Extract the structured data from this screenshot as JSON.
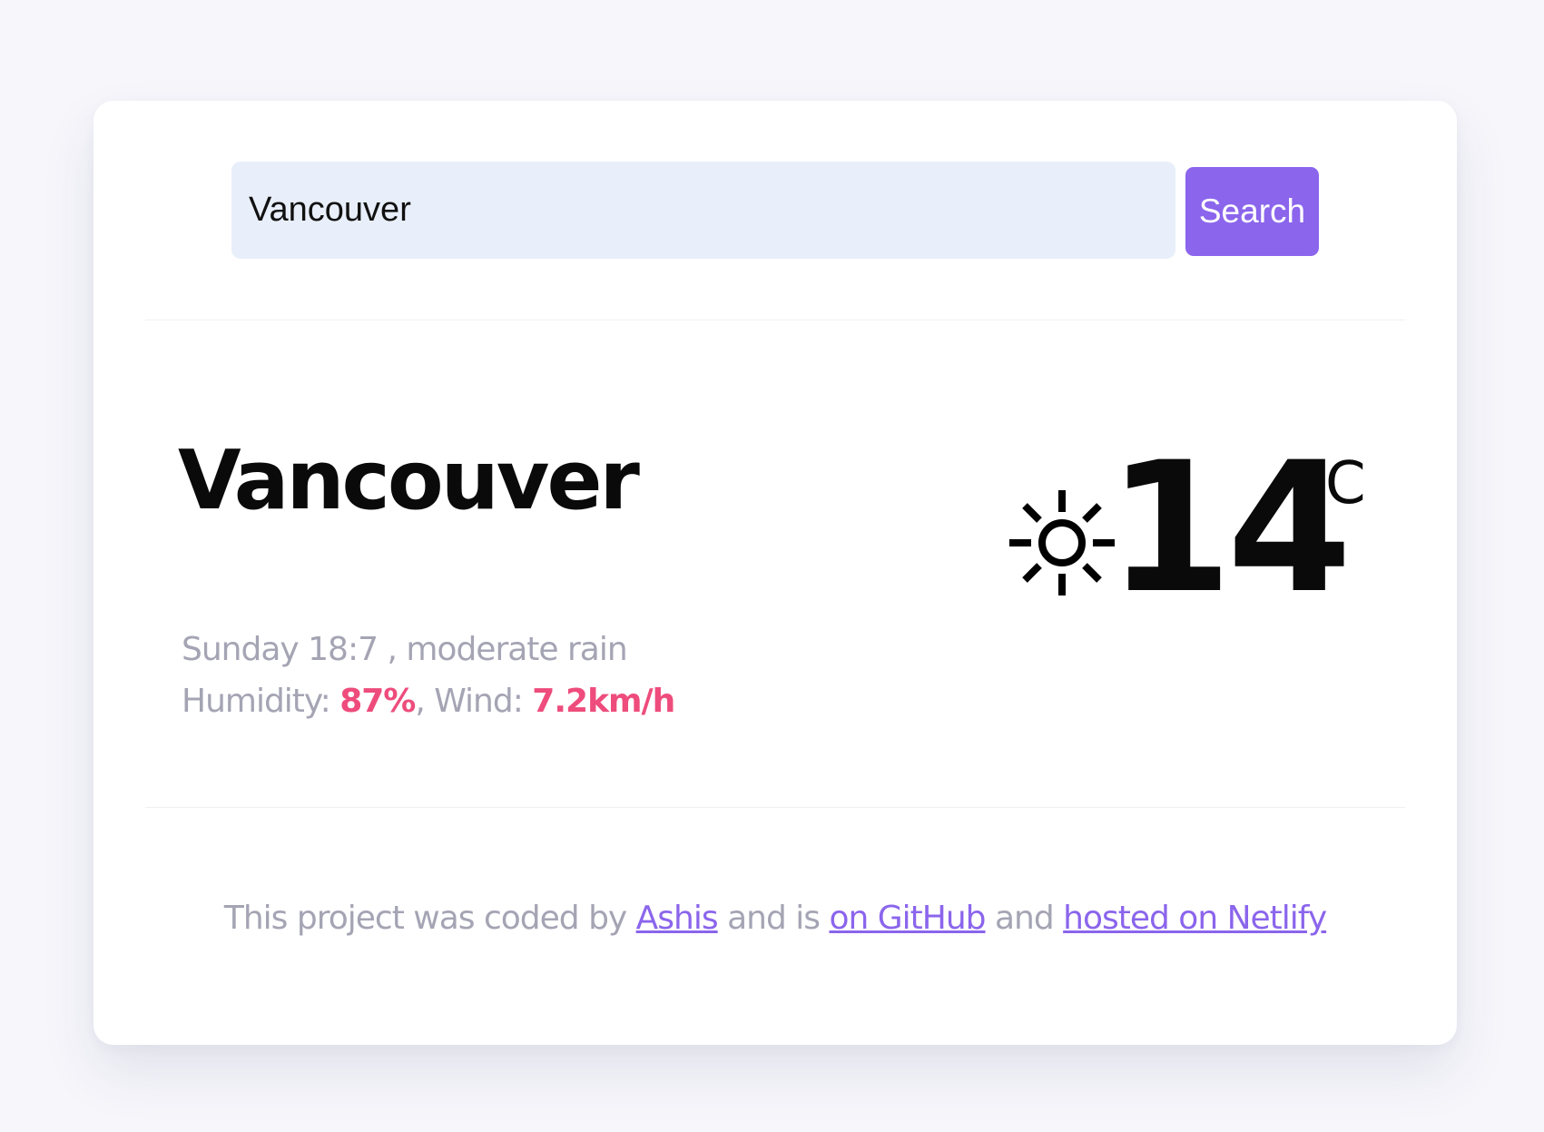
{
  "search": {
    "value": "Vancouver",
    "button_label": "Search"
  },
  "weather": {
    "city": "Vancouver",
    "day_time": "Sunday 18:7",
    "separator": " , ",
    "description": "moderate rain",
    "humidity_label": "Humidity: ",
    "humidity_value": "87%",
    "wind_sep": ", ",
    "wind_label": "Wind: ",
    "wind_value": "7.2km/h",
    "icon": "sun-icon",
    "temperature": "14",
    "unit": "°C"
  },
  "footer": {
    "text_1": "This project was coded by ",
    "link_author": "Ashis",
    "text_2": " and is ",
    "link_github": "on GitHub",
    "text_3": " and ",
    "link_netlify": "hosted on Netlify"
  },
  "colors": {
    "accent": "#8b65ec",
    "highlight": "#ee4c7c",
    "muted_text": "#a4a4b4",
    "input_bg": "#e8effa",
    "page_bg": "#f6f6fb"
  }
}
